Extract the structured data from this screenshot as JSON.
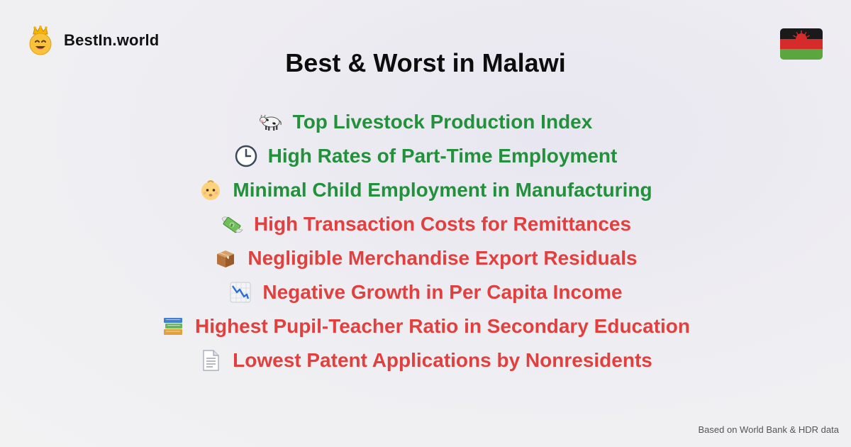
{
  "brand": {
    "name": "BestIn.world",
    "logo_icon": "crowned-smiley-icon"
  },
  "flag": {
    "country": "Malawi",
    "colors": [
      "#1a1a1a",
      "#d52b2b",
      "#5aa63f"
    ]
  },
  "title": "Best & Worst in Malawi",
  "colors": {
    "best": "#23913c",
    "worst": "#e0413f"
  },
  "items": [
    {
      "icon": "cow-icon",
      "kind": "best",
      "label": "Top Livestock Production Index"
    },
    {
      "icon": "clock-icon",
      "kind": "best",
      "label": "High Rates of Part-Time Employment"
    },
    {
      "icon": "baby-icon",
      "kind": "best",
      "label": "Minimal Child Employment in Manufacturing"
    },
    {
      "icon": "money-with-wings-icon",
      "kind": "worst",
      "label": "High Transaction Costs for Remittances"
    },
    {
      "icon": "package-icon",
      "kind": "worst",
      "label": "Negligible Merchandise Export Residuals"
    },
    {
      "icon": "chart-decreasing-icon",
      "kind": "worst",
      "label": "Negative Growth in Per Capita Income"
    },
    {
      "icon": "books-icon",
      "kind": "worst",
      "label": "Highest Pupil-Teacher Ratio in Secondary Education"
    },
    {
      "icon": "page-icon",
      "kind": "worst",
      "label": "Lowest Patent Applications by Nonresidents"
    }
  ],
  "footer": "Based on World Bank & HDR data"
}
